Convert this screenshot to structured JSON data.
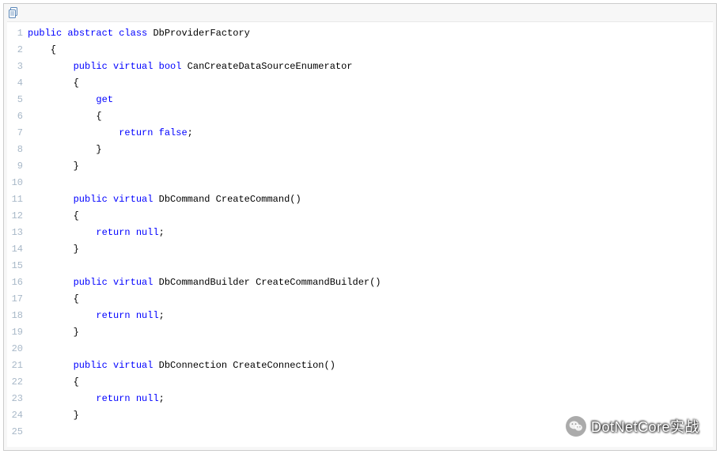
{
  "toolbar": {
    "copy_icon_name": "copy-icon"
  },
  "code": {
    "lines": [
      {
        "n": 1,
        "tokens": [
          {
            "t": "public",
            "c": "kw"
          },
          {
            "t": " ",
            "c": "punc"
          },
          {
            "t": "abstract",
            "c": "kw"
          },
          {
            "t": " ",
            "c": "punc"
          },
          {
            "t": "class",
            "c": "kw"
          },
          {
            "t": " DbProviderFactory",
            "c": "punc"
          }
        ]
      },
      {
        "n": 2,
        "tokens": [
          {
            "t": "    {",
            "c": "punc"
          }
        ]
      },
      {
        "n": 3,
        "tokens": [
          {
            "t": "        ",
            "c": "punc"
          },
          {
            "t": "public",
            "c": "kw"
          },
          {
            "t": " ",
            "c": "punc"
          },
          {
            "t": "virtual",
            "c": "kw"
          },
          {
            "t": " ",
            "c": "punc"
          },
          {
            "t": "bool",
            "c": "kw"
          },
          {
            "t": " CanCreateDataSourceEnumerator",
            "c": "punc"
          }
        ]
      },
      {
        "n": 4,
        "tokens": [
          {
            "t": "        {",
            "c": "punc"
          }
        ]
      },
      {
        "n": 5,
        "tokens": [
          {
            "t": "            ",
            "c": "punc"
          },
          {
            "t": "get",
            "c": "kw"
          }
        ]
      },
      {
        "n": 6,
        "tokens": [
          {
            "t": "            {",
            "c": "punc"
          }
        ]
      },
      {
        "n": 7,
        "tokens": [
          {
            "t": "                ",
            "c": "punc"
          },
          {
            "t": "return",
            "c": "kw"
          },
          {
            "t": " ",
            "c": "punc"
          },
          {
            "t": "false",
            "c": "kw"
          },
          {
            "t": ";",
            "c": "punc"
          }
        ]
      },
      {
        "n": 8,
        "tokens": [
          {
            "t": "            }",
            "c": "punc"
          }
        ]
      },
      {
        "n": 9,
        "tokens": [
          {
            "t": "        }",
            "c": "punc"
          }
        ]
      },
      {
        "n": 10,
        "tokens": []
      },
      {
        "n": 11,
        "tokens": [
          {
            "t": "        ",
            "c": "punc"
          },
          {
            "t": "public",
            "c": "kw"
          },
          {
            "t": " ",
            "c": "punc"
          },
          {
            "t": "virtual",
            "c": "kw"
          },
          {
            "t": " DbCommand CreateCommand()",
            "c": "punc"
          }
        ]
      },
      {
        "n": 12,
        "tokens": [
          {
            "t": "        {",
            "c": "punc"
          }
        ]
      },
      {
        "n": 13,
        "tokens": [
          {
            "t": "            ",
            "c": "punc"
          },
          {
            "t": "return",
            "c": "kw"
          },
          {
            "t": " ",
            "c": "punc"
          },
          {
            "t": "null",
            "c": "kw"
          },
          {
            "t": ";",
            "c": "punc"
          }
        ]
      },
      {
        "n": 14,
        "tokens": [
          {
            "t": "        }",
            "c": "punc"
          }
        ]
      },
      {
        "n": 15,
        "tokens": []
      },
      {
        "n": 16,
        "tokens": [
          {
            "t": "        ",
            "c": "punc"
          },
          {
            "t": "public",
            "c": "kw"
          },
          {
            "t": " ",
            "c": "punc"
          },
          {
            "t": "virtual",
            "c": "kw"
          },
          {
            "t": " DbCommandBuilder CreateCommandBuilder()",
            "c": "punc"
          }
        ]
      },
      {
        "n": 17,
        "tokens": [
          {
            "t": "        {",
            "c": "punc"
          }
        ]
      },
      {
        "n": 18,
        "tokens": [
          {
            "t": "            ",
            "c": "punc"
          },
          {
            "t": "return",
            "c": "kw"
          },
          {
            "t": " ",
            "c": "punc"
          },
          {
            "t": "null",
            "c": "kw"
          },
          {
            "t": ";",
            "c": "punc"
          }
        ]
      },
      {
        "n": 19,
        "tokens": [
          {
            "t": "        }",
            "c": "punc"
          }
        ]
      },
      {
        "n": 20,
        "tokens": []
      },
      {
        "n": 21,
        "tokens": [
          {
            "t": "        ",
            "c": "punc"
          },
          {
            "t": "public",
            "c": "kw"
          },
          {
            "t": " ",
            "c": "punc"
          },
          {
            "t": "virtual",
            "c": "kw"
          },
          {
            "t": " DbConnection CreateConnection()",
            "c": "punc"
          }
        ]
      },
      {
        "n": 22,
        "tokens": [
          {
            "t": "        {",
            "c": "punc"
          }
        ]
      },
      {
        "n": 23,
        "tokens": [
          {
            "t": "            ",
            "c": "punc"
          },
          {
            "t": "return",
            "c": "kw"
          },
          {
            "t": " ",
            "c": "punc"
          },
          {
            "t": "null",
            "c": "kw"
          },
          {
            "t": ";",
            "c": "punc"
          }
        ]
      },
      {
        "n": 24,
        "tokens": [
          {
            "t": "        }",
            "c": "punc"
          }
        ]
      },
      {
        "n": 25,
        "tokens": []
      }
    ]
  },
  "watermark": {
    "text": "DotNetCore实战"
  }
}
